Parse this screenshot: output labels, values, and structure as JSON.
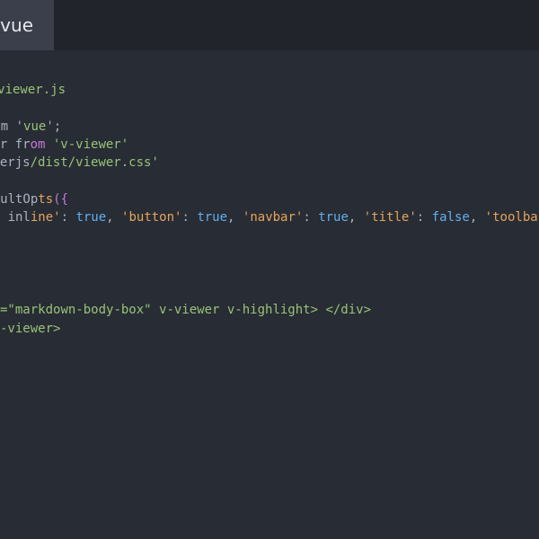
{
  "tab": {
    "title": "Page.vue"
  },
  "code": {
    "line1": "plugins/viewer.js",
    "line2_prefix": "import Vue from '",
    "line2_visible": "vue",
    "line2_end": "';",
    "line3_prefix": "import Viewer fr",
    "line3_keyword": "om",
    "line3_space": " ",
    "line3_string": "'v-viewer'",
    "line4_prefix": "import 'viewerjs",
    "line4_string": "/dist/viewer.css'",
    "line5_prefix": "Vue.use(Viewer, { defaultOp",
    "line5_fn": "ts",
    "line5_brace": "({",
    "line6_prefix": "  inl",
    "line6_key": "ine'",
    "line6_colon1": ": ",
    "line6_val1": "true",
    "line6_comma1": ", ",
    "line6_key2": "'button'",
    "line6_colon2": ": ",
    "line6_val2": "true",
    "line6_comma2": ", ",
    "line6_key3": "'navbar'",
    "line6_colon3": ": ",
    "line6_val3": "true",
    "line6_comma3": ", ",
    "line6_key4": "'title'",
    "line6_colon4": ": ",
    "line6_val4": "false",
    "line6_comma4": ", ",
    "line6_key5": "'toolbar'",
    "line6_colon5": ": ",
    "line6_val5": "true",
    "line7_prefix": "<div class=\"ma",
    "line7_text": "rkdown-body-box\" v-viewer v-highlight> </div>",
    "line8_prefix": "</v-vie",
    "line8_text": "wer>"
  }
}
